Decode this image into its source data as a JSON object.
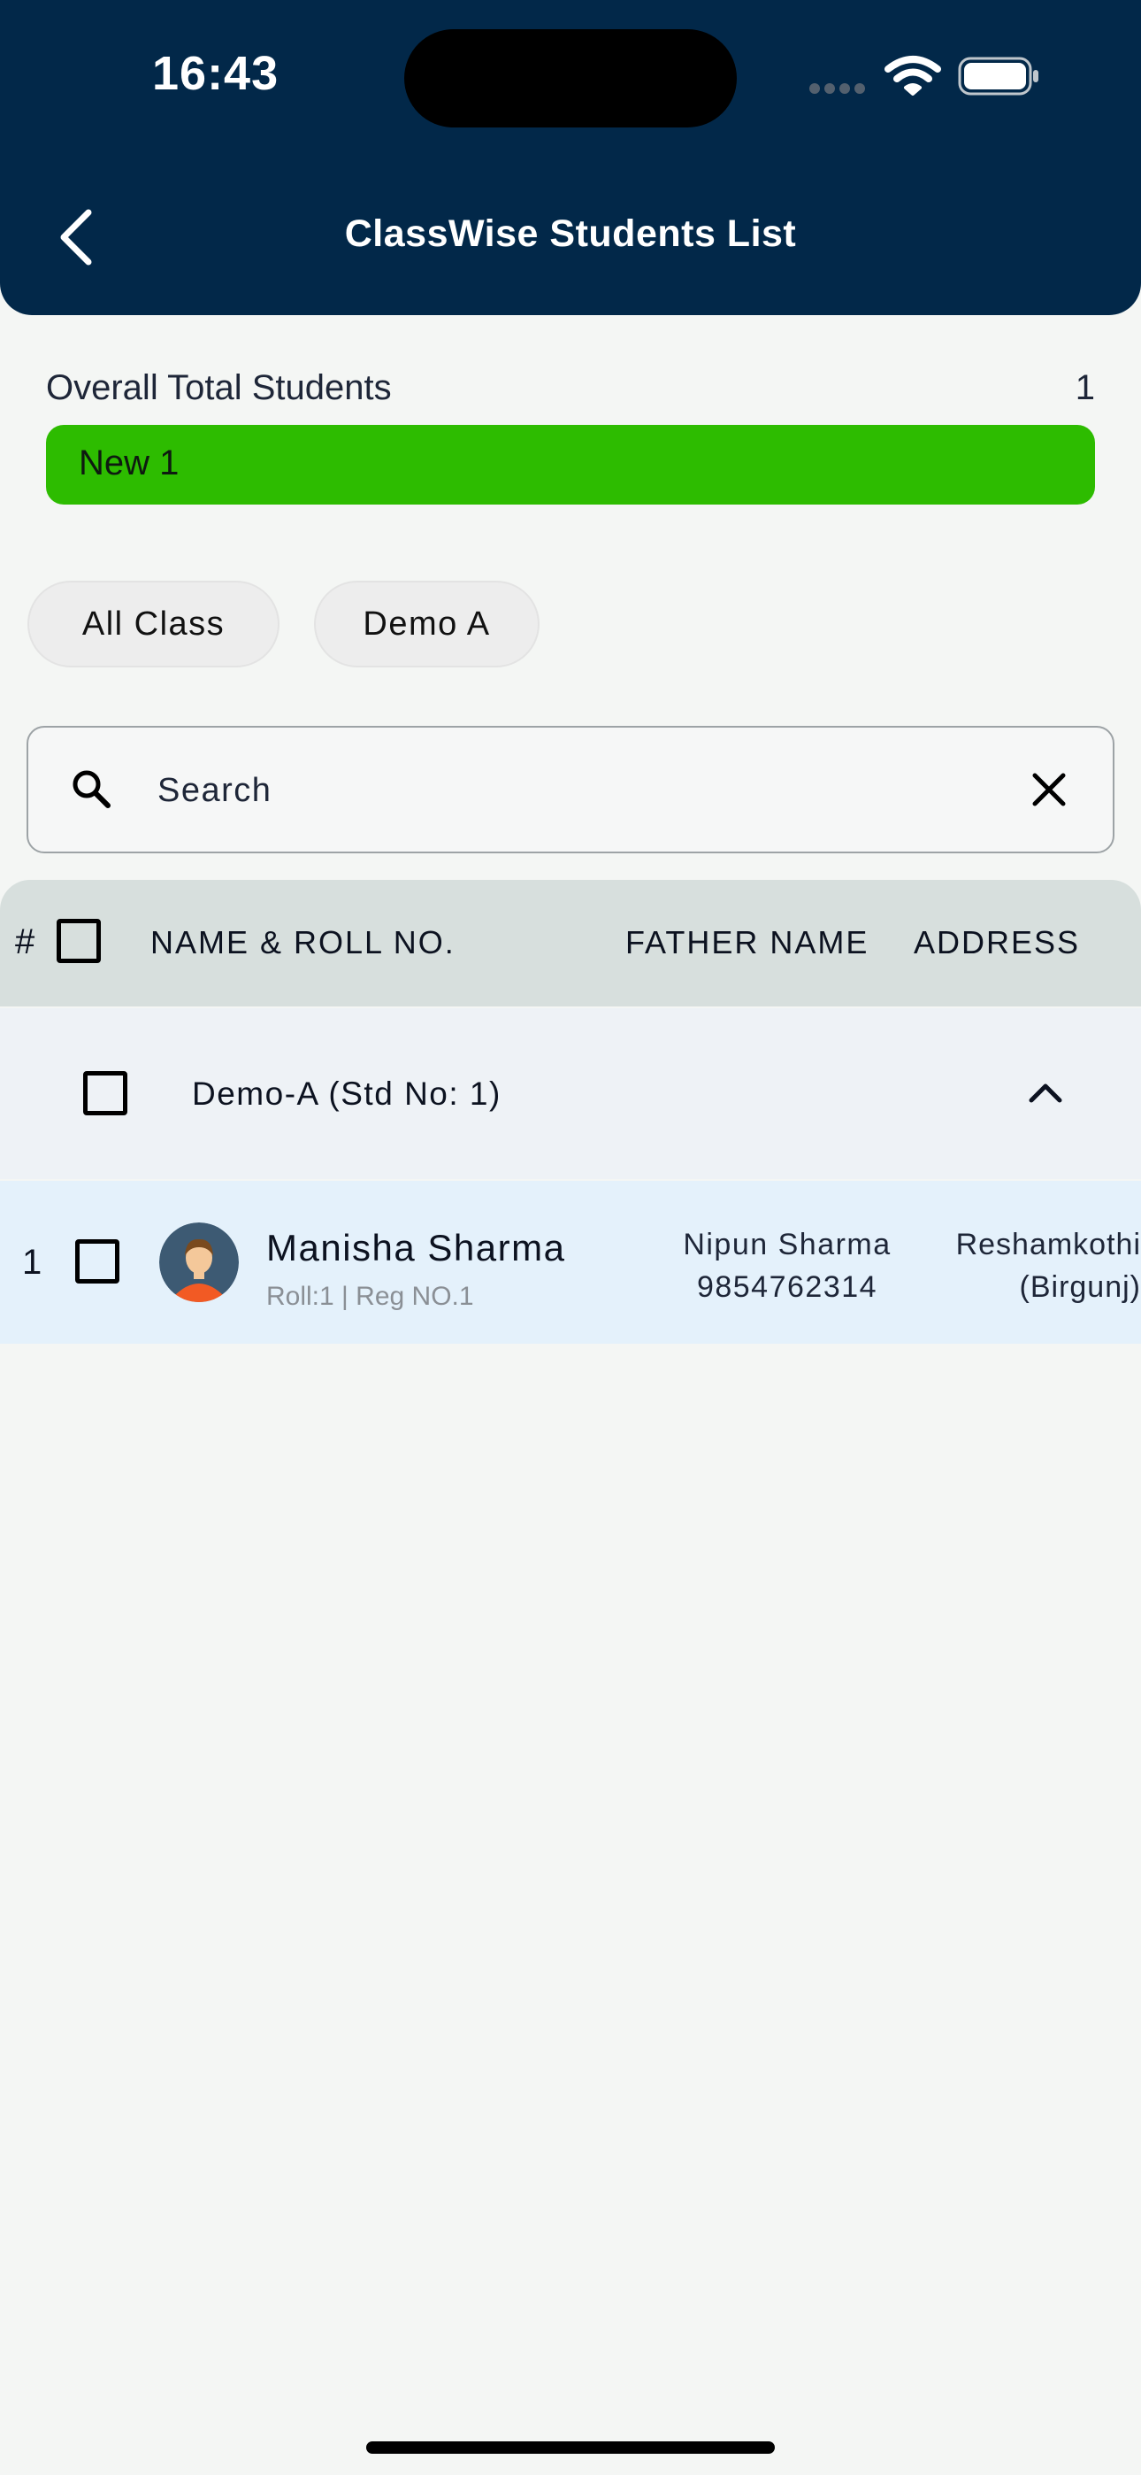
{
  "status_bar": {
    "time": "16:43"
  },
  "header": {
    "title": "ClassWise Students List"
  },
  "summary": {
    "label": "Overall Total Students",
    "count": "1",
    "new_label": "New 1"
  },
  "filters": [
    {
      "label": "All Class"
    },
    {
      "label": "Demo  A"
    }
  ],
  "search": {
    "placeholder": "Search"
  },
  "table": {
    "headers": {
      "index": "#",
      "name": "NAME & ROLL NO.",
      "father": "FATHER NAME",
      "address": "ADDRESS"
    },
    "groups": [
      {
        "label": "Demo-A (Std No: 1)",
        "rows": [
          {
            "index": "1",
            "name": "Manisha Sharma",
            "sub": "Roll:1 | Reg NO.1",
            "father_name": "Nipun Sharma",
            "father_phone": "9854762314",
            "address_line1": "Reshamkothi",
            "address_line2": "(Birgunj)"
          }
        ]
      }
    ]
  },
  "colors": {
    "header_bg": "#022849",
    "new_bar": "#2DBC00",
    "row_bg": "#E4F1FB",
    "table_head": "#D7DFDD"
  }
}
